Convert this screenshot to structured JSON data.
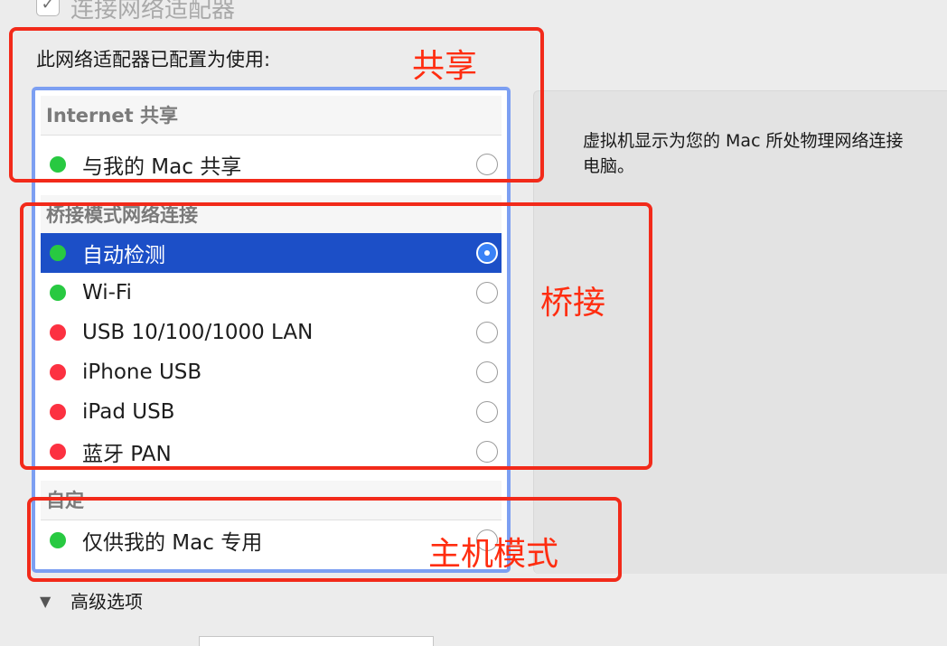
{
  "enable_adapter": {
    "label": "连接网络适配器",
    "checked": true
  },
  "prompt": "此网络适配器已配置为使用:",
  "info_text": {
    "line1": "虚拟机显示为您的 Mac 所处物理网络连接",
    "line2": "电脑。"
  },
  "list": {
    "sections": [
      {
        "header": "Internet 共享",
        "rows": [
          {
            "label": "与我的 Mac 共享",
            "status": "green",
            "selected": false
          }
        ]
      },
      {
        "header": "桥接模式网络连接",
        "rows": [
          {
            "label": "自动检测",
            "status": "green",
            "selected": true
          },
          {
            "label": "Wi-Fi",
            "status": "green",
            "selected": false
          },
          {
            "label": "USB 10/100/1000 LAN",
            "status": "red",
            "selected": false
          },
          {
            "label": "iPhone USB",
            "status": "red",
            "selected": false
          },
          {
            "label": "iPad USB",
            "status": "red",
            "selected": false
          },
          {
            "label": "蓝牙 PAN",
            "status": "red",
            "selected": false
          }
        ]
      },
      {
        "header": "自定",
        "rows": [
          {
            "label": "仅供我的 Mac 专用",
            "status": "green",
            "selected": false
          }
        ]
      }
    ]
  },
  "annotations": {
    "sharing": "共享",
    "bridge": "桥接",
    "host_only": "主机模式"
  },
  "advanced": {
    "label": "高级选项",
    "icon": "disclosure-triangle-down-icon"
  },
  "colors": {
    "green": "#28c941",
    "red": "#fc3141",
    "selection": "#1c4fc7",
    "focus_ring": "#7c9ff2",
    "annotation": "#f22a1a"
  }
}
